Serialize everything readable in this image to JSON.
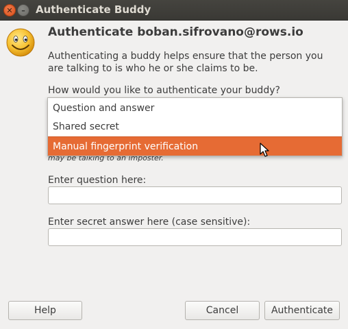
{
  "window": {
    "title": "Authenticate Buddy",
    "close_glyph": "✕",
    "minimize_glyph": "–"
  },
  "avatar": {
    "icon": "smiley-face-icon"
  },
  "header": {
    "title": "Authenticate boban.sifrovano@rows.io",
    "description": "Authenticating a buddy helps ensure that the person you are talking to is who he or she claims to be.",
    "question": "How would you like to authenticate your buddy?"
  },
  "method_dropdown": {
    "options": [
      "Question and answer",
      "Shared secret",
      "Manual fingerprint verification"
    ],
    "highlighted": "Manual fingerprint verification"
  },
  "partial_text": "may be talking to an imposter.",
  "form": {
    "question_label": "Enter question here:",
    "question_value": "",
    "answer_label": "Enter secret answer here (case sensitive):",
    "answer_value": ""
  },
  "buttons": {
    "help": "Help",
    "cancel": "Cancel",
    "authenticate": "Authenticate"
  },
  "colors": {
    "highlight": "#e66b34",
    "titlebar": "#3f3e3a"
  }
}
